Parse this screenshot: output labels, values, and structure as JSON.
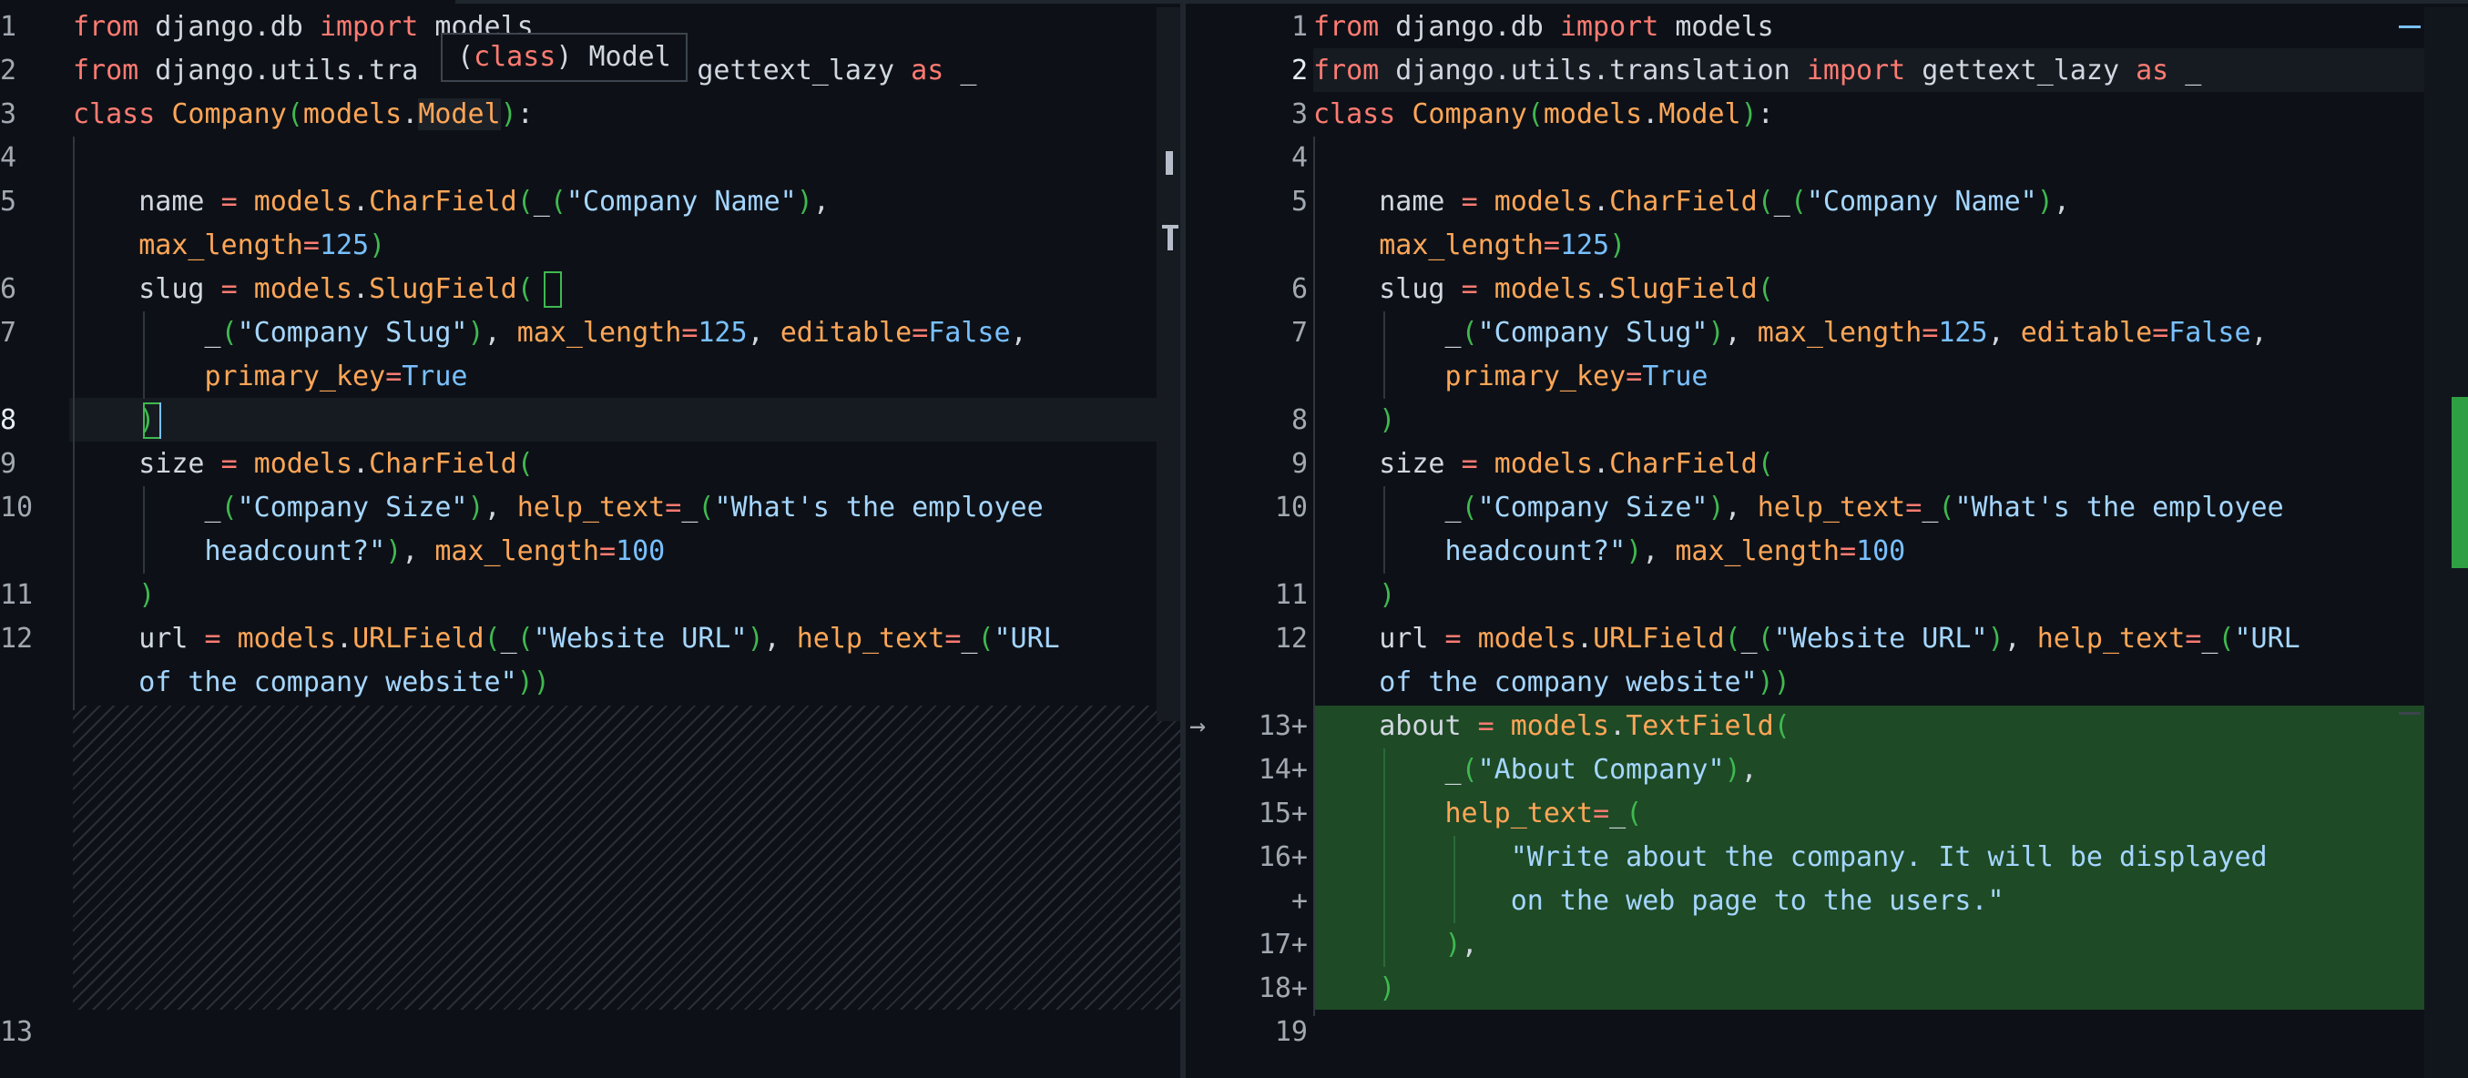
{
  "tooltip": {
    "kind": "class",
    "name": "Model"
  },
  "left": {
    "line_numbers": [
      "1",
      "2",
      "3",
      "4",
      "5",
      "",
      "6",
      "7",
      "",
      "8",
      "9",
      "10",
      "",
      "11",
      "12",
      "",
      "13"
    ],
    "lines": [
      [
        [
          "kw",
          "from"
        ],
        [
          "",
          "  django.db "
        ],
        [
          "kw",
          "import"
        ],
        [
          "",
          " models"
        ]
      ],
      [
        [
          "kw",
          "from"
        ],
        [
          "",
          " django.utils.translation "
        ],
        [
          "kw",
          "import"
        ],
        [
          "",
          " gettext_lazy "
        ],
        [
          "kw",
          "as"
        ],
        [
          "",
          " _"
        ]
      ],
      [
        [
          "kw",
          "class"
        ],
        [
          "",
          " "
        ],
        [
          "cls",
          "Company"
        ],
        [
          "par",
          "("
        ],
        [
          "cls",
          "models"
        ],
        [
          "",
          "."
        ],
        [
          "cls",
          "Model"
        ],
        [
          "par",
          ")"
        ],
        [
          "",
          ":"
        ]
      ]
    ]
  },
  "left_code": {
    "l1a": "from",
    "l1b": " django.db ",
    "l1c": "import",
    "l1d": " models",
    "l2a": "from",
    "l2b": " django.utils.tra",
    "l2c": " gettext_lazy ",
    "l2d": "as",
    "l2e": " _",
    "l3a": "class",
    "l3b": " ",
    "l3c": "Company",
    "l3d": "(",
    "l3e": "models",
    "l3f": ".",
    "l3g": "Model",
    "l3h": ")",
    "l3i": ":",
    "l5a": "    name ",
    "l5b": "=",
    "l5c": " ",
    "l5d": "models",
    "l5e": ".",
    "l5f": "CharField",
    "l5g": "(",
    "l5h": "_",
    "l5i": "(",
    "l5j": "\"Company Name\"",
    "l5k": ")",
    "l5l": ",",
    "l5wa": "    ",
    "l5wb": "max_length",
    "l5wc": "=",
    "l5wd": "125",
    "l5we": ")",
    "l6a": "    slug ",
    "l6b": "=",
    "l6c": " ",
    "l6d": "models",
    "l6e": ".",
    "l6f": "SlugField",
    "l6g": "(",
    "l7a": "        _",
    "l7b": "(",
    "l7c": "\"Company Slug\"",
    "l7d": ")",
    "l7e": ", ",
    "l7f": "max_length",
    "l7g": "=",
    "l7h": "125",
    "l7i": ", ",
    "l7j": "editable",
    "l7k": "=",
    "l7l": "False",
    "l7m": ",",
    "l7wa": "        ",
    "l7wb": "primary_key",
    "l7wc": "=",
    "l7wd": "True",
    "l8a": "    ",
    "l8b": ")",
    "l9a": "    size ",
    "l9b": "=",
    "l9c": " ",
    "l9d": "models",
    "l9e": ".",
    "l9f": "CharField",
    "l9g": "(",
    "l10a": "        _",
    "l10b": "(",
    "l10c": "\"Company Size\"",
    "l10d": ")",
    "l10e": ", ",
    "l10f": "help_text",
    "l10g": "=",
    "l10h": "_",
    "l10i": "(",
    "l10j": "\"What's the employee",
    "l10wa": "        ",
    "l10wb": "headcount?\"",
    "l10wc": ")",
    "l10wd": ", ",
    "l10we": "max_length",
    "l10wf": "=",
    "l10wg": "100",
    "l11a": "    ",
    "l11b": ")",
    "l12a": "    url ",
    "l12b": "=",
    "l12c": " ",
    "l12d": "models",
    "l12e": ".",
    "l12f": "URLField",
    "l12g": "(",
    "l12h": "_",
    "l12i": "(",
    "l12j": "\"Website URL\"",
    "l12k": ")",
    "l12l": ", ",
    "l12m": "help_text",
    "l12n": "=",
    "l12o": "_",
    "l12p": "(",
    "l12q": "\"URL",
    "l12wa": "    ",
    "l12wb": "of the company website\"",
    "l12wc": "))"
  },
  "right_code": {
    "n": [
      "1",
      "2",
      "3",
      "4",
      "5",
      "",
      "6",
      "7",
      "",
      "8",
      "9",
      "10",
      "",
      "11",
      "12",
      "",
      "13+",
      "14+",
      "15+",
      "16+",
      "+",
      "17+",
      "18+",
      "19"
    ],
    "l1a": "from",
    "l1b": " django.db ",
    "l1c": "import",
    "l1d": " models",
    "l2a": "from",
    "l2b": " django.utils.translation ",
    "l2c": "import",
    "l2d": " gettext_lazy ",
    "l2e": "as",
    "l2f": " _",
    "l13a": "    about ",
    "l13b": "=",
    "l13c": " ",
    "l13d": "models",
    "l13e": ".",
    "l13f": "TextField",
    "l13g": "(",
    "l14a": "        _",
    "l14b": "(",
    "l14c": "\"About Company\"",
    "l14d": ")",
    "l14e": ",",
    "l15a": "        ",
    "l15b": "help_text",
    "l15c": "=",
    "l15d": "_",
    "l15e": "(",
    "l16a": "            ",
    "l16b": "\"Write about the company. It will be displayed",
    "l16wa": "            ",
    "l16wb": "on the web page to the users.\"",
    "l17a": "        ",
    "l17b": ")",
    "l17c": ",",
    "l18a": "    ",
    "l18b": ")"
  },
  "icons": {
    "diff_arrow": "→"
  },
  "colors": {
    "background": "#0d1117",
    "added_block": "#1e4a26",
    "keyword": "#ff7b72",
    "class_name": "#ffa657",
    "string": "#a5d6ff",
    "number": "#79c0ff",
    "bracket": "#3fb950"
  }
}
